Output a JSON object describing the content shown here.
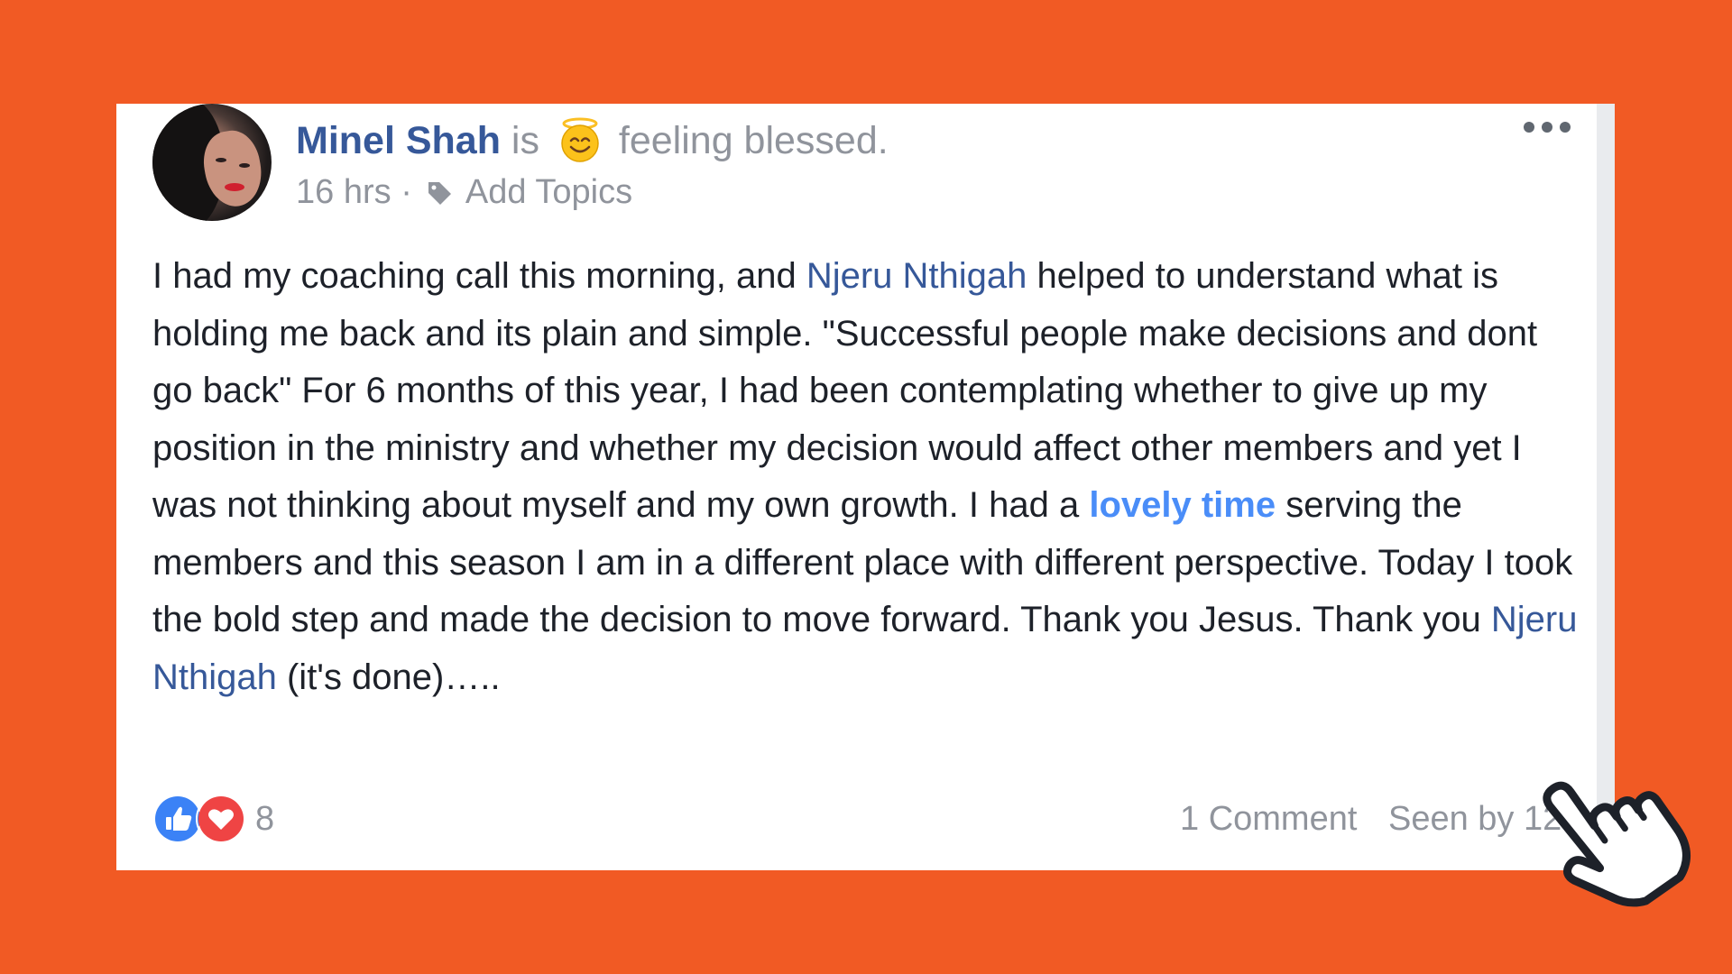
{
  "post": {
    "author": "Minel Shah",
    "verb": "is",
    "feeling": "feeling blessed.",
    "time": "16 hrs",
    "separator": "·",
    "add_topics": "Add Topics",
    "more_label": "•••",
    "body_parts": {
      "p1": "I had my coaching call this morning, and ",
      "mention1": "Njeru Nthigah",
      "p2": " helped to understand what is holding me back and its plain and simple. \"Successful people make decisions and dont go back\" For 6 months of this year, I had been contemplating whether to give up my position in the ministry and whether my decision would affect other members and yet I was not thinking about myself and my own growth. I had a ",
      "highlight": "lovely time",
      "p3": " serving the members and this season I am in a different place with different perspective. Today I took the bold step and made the decision to move forward. Thank you Jesus. Thank you ",
      "mention2": "Njeru Nthigah",
      "p4": " (it's done)….."
    },
    "reactions": {
      "types": [
        "like-icon",
        "love-icon"
      ],
      "count": "8"
    },
    "comments": "1 Comment",
    "seen_by": "Seen by 12"
  },
  "colors": {
    "background": "#f15a24",
    "link": "#365899",
    "highlight": "#4a8df8",
    "like": "#3b82f6",
    "love": "#ef4444"
  }
}
